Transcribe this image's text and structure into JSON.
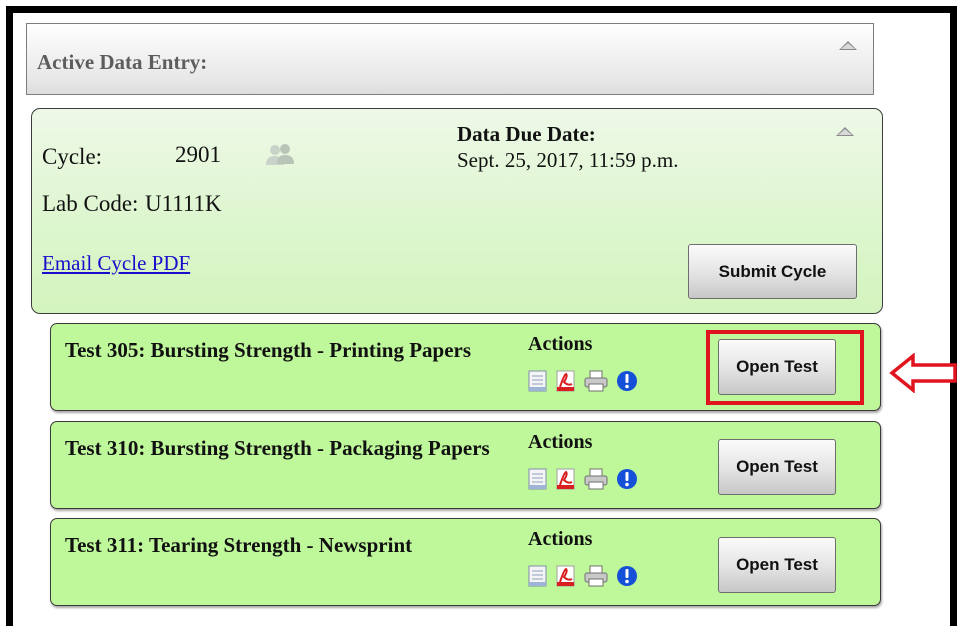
{
  "header": {
    "title": "Active Data Entry:"
  },
  "cycle": {
    "cycle_label": "Cycle:",
    "cycle_value": "2901",
    "lab_code_label": "Lab Code:",
    "lab_code_value": "U1111K",
    "due_title": "Data Due Date:",
    "due_value": "Sept. 25, 2017, 11:59 p.m.",
    "email_link": "Email Cycle PDF",
    "submit_label": "Submit Cycle"
  },
  "tests": [
    {
      "name": "Test 305: Bursting Strength - Printing Papers",
      "actions_label": "Actions",
      "open_label": "Open Test"
    },
    {
      "name": "Test 310: Bursting Strength - Packaging Papers",
      "actions_label": "Actions",
      "open_label": "Open Test"
    },
    {
      "name": "Test 311: Tearing Strength - Newsprint",
      "actions_label": "Actions",
      "open_label": "Open Test"
    }
  ],
  "icons": {
    "collapse": "triangle-up-icon",
    "people": "people-icon",
    "actions": [
      "document-icon",
      "pdf-icon",
      "printer-icon",
      "info-icon"
    ],
    "arrow": "left-arrow-icon"
  },
  "colors": {
    "panel_green": "#bff79b",
    "highlight_red": "#e0141e",
    "link_blue": "#1a0dcc",
    "info_blue": "#1550d8"
  }
}
